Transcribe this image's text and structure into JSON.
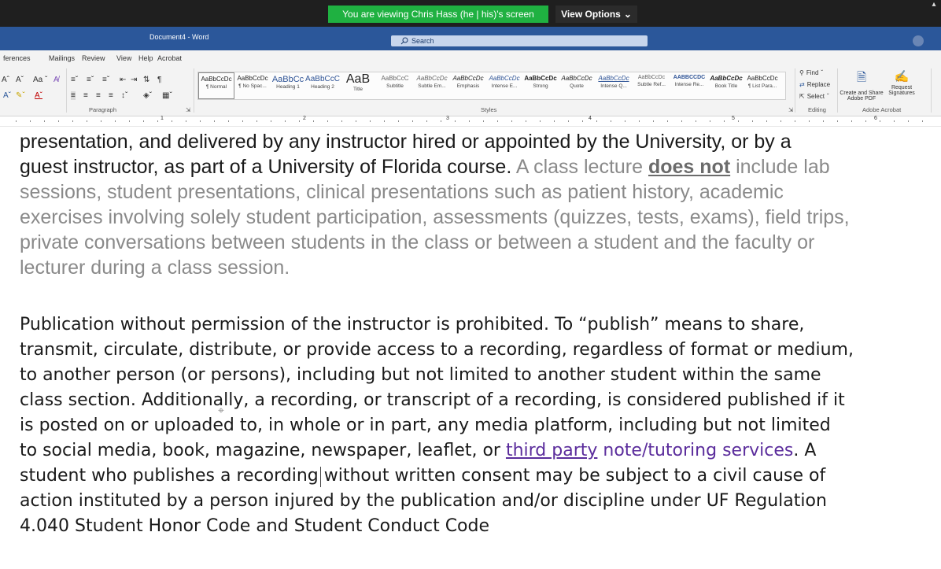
{
  "share_bar": {
    "banner_text": "You are viewing Chris Hass (he | his)'s screen",
    "view_options_label": "View Options",
    "view_options_icon": "chevron-down-icon"
  },
  "word": {
    "title": "Document4 - Word",
    "search_placeholder": "Search"
  },
  "tabs": [
    "ferences",
    "Mailings",
    "Review",
    "View",
    "Help",
    "Acrobat"
  ],
  "ribbon": {
    "paragraph_label": "Paragraph",
    "styles_label": "Styles",
    "editing_label": "Editing",
    "acrobat_label": "Adobe Acrobat",
    "font_size_buttons": [
      "Aˆ",
      "Aˇ",
      "Aa ˇ"
    ],
    "styles": [
      {
        "sample": "AaBbCcDc",
        "name": "¶ Normal"
      },
      {
        "sample": "AaBbCcDc",
        "name": "¶ No Spac..."
      },
      {
        "sample": "AaBbCc",
        "name": "Heading 1"
      },
      {
        "sample": "AaBbCcC",
        "name": "Heading 2"
      },
      {
        "sample": "AaB",
        "name": "Title"
      },
      {
        "sample": "AaBbCcC",
        "name": "Subtitle"
      },
      {
        "sample": "AaBbCcDc",
        "name": "Subtle Em..."
      },
      {
        "sample": "AaBbCcDc",
        "name": "Emphasis"
      },
      {
        "sample": "AaBbCcDc",
        "name": "Intense E..."
      },
      {
        "sample": "AaBbCcDc",
        "name": "Strong"
      },
      {
        "sample": "AaBbCcDc",
        "name": "Quote"
      },
      {
        "sample": "AaBbCcDc",
        "name": "Intense Q..."
      },
      {
        "sample": "AaBbCcDc",
        "name": "Subtle Ref..."
      },
      {
        "sample": "AABBCCDC",
        "name": "Intense Re..."
      },
      {
        "sample": "AaBbCcDc",
        "name": "Book Title"
      },
      {
        "sample": "AaBbCcDc",
        "name": "¶ List Para..."
      }
    ],
    "editing": {
      "find": "Find",
      "replace": "Replace",
      "select": "Select"
    },
    "acrobat": {
      "create_share": "Create and Share Adobe PDF",
      "request_signatures": "Request Signatures"
    }
  },
  "ruler_numbers": [
    "1",
    "2",
    "3",
    "4",
    "5",
    "6"
  ],
  "document": {
    "para1": {
      "l1": "presentation, and delivered by any instructor hired or appointed by the University, or by a",
      "l2a": "guest instructor, as part of a University of Florida course.",
      "l2b": " A class lecture ",
      "l2c": "does not",
      "l2d": " include lab",
      "l3": "sessions, student presentations, clinical presentations such as patient history, academic",
      "l4": "exercises involving solely student participation, assessments (quizzes, tests, exams), field trips,",
      "l5": "private conversations between students in the class or between a student and the faculty or",
      "l6": "lecturer during a class session."
    },
    "para2": {
      "l1": "Publication without permission of the instructor is prohibited. To “publish” means to share,",
      "l2": "transmit, circulate, distribute, or provide access to a recording, regardless of format or medium,",
      "l3": "to another person (or persons), including but not limited to another student within the same",
      "l4": "class section. Additionally, a recording, or transcript of a recording, is considered published if it",
      "l5": "is posted on or uploaded to, in whole or in part, any media platform, including but not limited",
      "l6a": "to social media, book, magazine, newspaper, leaflet, or ",
      "l6link": "third party",
      "l6b": " note/tutoring services",
      "l6c": ". A",
      "l7": "student who publishes a recording without written consent may be subject to a civil cause of",
      "l8": "action instituted by a person injured by the publication and/or discipline under UF Regulation",
      "l9": "4.040 Student Honor Code and Student Conduct Code"
    }
  }
}
